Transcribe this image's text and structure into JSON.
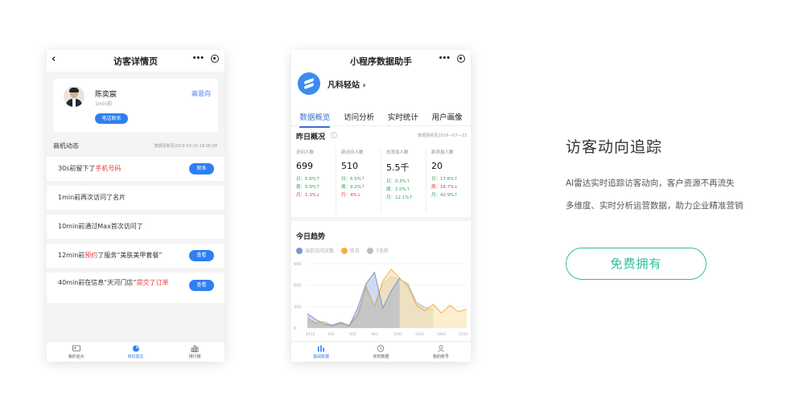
{
  "phone1": {
    "nav_title": "访客详情页",
    "back_icon": "‹",
    "profile": {
      "name": "陈奕宸",
      "time": "1min前",
      "link": "高意向",
      "button": "电话联系"
    },
    "section_title": "商机动态",
    "section_date": "数据更新至2019-03-10 19:00:08",
    "activities": [
      {
        "pre": "30s前留下了",
        "red": "手机号码",
        "post": "",
        "button": "联系"
      },
      {
        "pre": "1min前再次访问了名片",
        "red": "",
        "post": "",
        "button": ""
      },
      {
        "pre": "10min前通过Max首次访问了",
        "red": "",
        "post": "",
        "button": ""
      },
      {
        "pre": "12min前",
        "red": "预约",
        "post": "了服务“美肤美甲套餐”",
        "button": "查看"
      },
      {
        "pre": "40min前在信息“天河门店”",
        "red": "提交了订单",
        "post": "",
        "button": "查看"
      }
    ],
    "tabs": [
      "我的名片",
      "商机雷达",
      "排行榜"
    ]
  },
  "phone2": {
    "nav_title": "小程序数据助手",
    "site_name": "凡科轻站 ›",
    "tabs": [
      "数据概览",
      "访问分析",
      "实时统计",
      "用户画像"
    ],
    "yesterday_title": "昨日概况",
    "info_icon": "i",
    "yesterday_date": "数据更新至2019—07—23",
    "stats": [
      {
        "label": "访问人数",
        "value": "699",
        "day": "日：5.6%↑",
        "week": "周：5.9%↑",
        "month": "月：1.3%↓",
        "dc": "g",
        "wc": "g",
        "mc": "r"
      },
      {
        "label": "新访问人数",
        "value": "510",
        "day": "日：6.5%↑",
        "week": "周：9.2%↑",
        "month": "月：4%↓",
        "dc": "g",
        "wc": "g",
        "mc": "r"
      },
      {
        "label": "总添加人数",
        "value": "5.5千",
        "day": "日：0.3%↑",
        "week": "周：2.0%↑",
        "month": "月：12.1%↑",
        "dc": "g",
        "wc": "g",
        "mc": "g"
      },
      {
        "label": "新添加人数",
        "value": "20",
        "day": "日：17.6%↑",
        "week": "周：16.7%↓",
        "month": "月：42.9%↑",
        "dc": "g",
        "wc": "r",
        "mc": "g"
      }
    ],
    "trend_title": "今日趋势",
    "legend": [
      "当前访问次数",
      "昨日",
      "7天前"
    ],
    "tabs_bottom": [
      "基础数据",
      "实时数据",
      "我的账号"
    ]
  },
  "right": {
    "title": "访客动向追踪",
    "desc1": "AI雷达实时追踪访客动向，客户资源不再流失",
    "desc2": "多维度、实时分析运营数据，助力企业精准营销",
    "button": "免费拥有"
  },
  "colors": {
    "accent": "#2e7ff2",
    "green_cta": "#2bbf9a",
    "today": "#7f95d1",
    "yesterday": "#f0b23a",
    "week_ago": "#bdbdbd"
  },
  "chart_data": {
    "type": "area",
    "title": "今日趋势",
    "x": [
      "2412",
      "302",
      "602",
      "902",
      "1202",
      "1502",
      "1802",
      "2102"
    ],
    "yticks": [
      "900",
      "600",
      "300",
      "0"
    ],
    "ylim": [
      0,
      900
    ],
    "series": [
      {
        "name": "当前访问次数",
        "values": [
          200,
          120,
          60,
          40,
          80,
          30,
          280,
          620,
          780,
          280,
          520,
          700
        ]
      },
      {
        "name": "昨日",
        "values": [
          140,
          70,
          90,
          30,
          70,
          40,
          160,
          580,
          300,
          660,
          820,
          700,
          580,
          320,
          240,
          330,
          210,
          320,
          230,
          260
        ]
      },
      {
        "name": "7天前",
        "values": [
          110,
          60,
          40,
          30,
          60,
          40,
          200,
          560,
          300,
          620,
          720,
          680,
          620,
          360,
          290,
          260
        ]
      }
    ],
    "grid": true,
    "legend_position": "top-left"
  }
}
